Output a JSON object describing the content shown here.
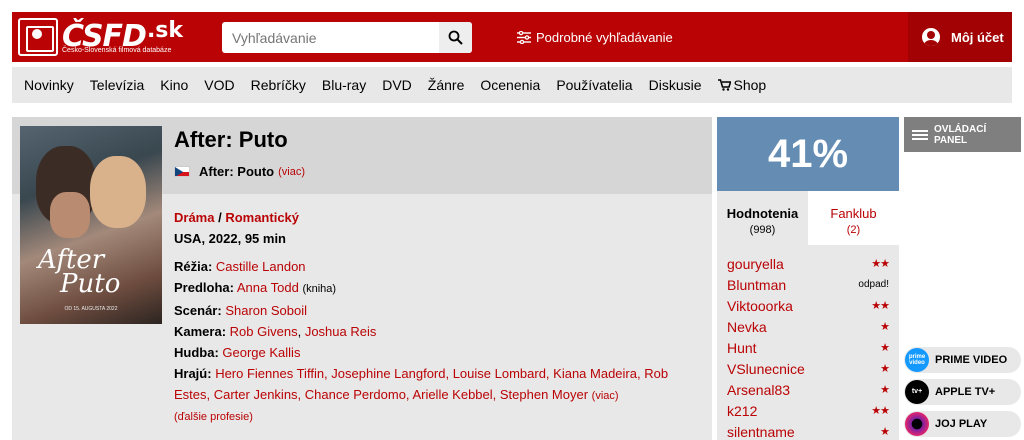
{
  "header": {
    "logo_text": "ČSFD",
    "logo_domain": ".sk",
    "logo_tagline": "Česko-Slovenská filmová databáze",
    "search_placeholder": "Vyhľadávanie",
    "advanced_search": "Podrobné vyhľadávanie",
    "account": "Môj účet"
  },
  "nav": {
    "items": [
      "Novinky",
      "Televízia",
      "Kino",
      "VOD",
      "Rebríčky",
      "Blu-ray",
      "DVD",
      "Žánre",
      "Ocenenia",
      "Používatelia",
      "Diskusie",
      "Shop"
    ]
  },
  "film": {
    "title": "After: Puto",
    "original_title": "After: Pouto",
    "original_more": "(viac)",
    "genre1": "Dráma",
    "genre_sep": " / ",
    "genre2": "Romantický",
    "meta": "USA, 2022, 95 min",
    "poster": {
      "title_line1": "After",
      "title_line2": "Puto",
      "footer": "OD 15. AUGUSTA 2022"
    },
    "crew": [
      {
        "label": "Réžia:",
        "names": [
          "Castille Landon"
        ]
      },
      {
        "label": "Predloha:",
        "names": [
          "Anna Todd"
        ],
        "note": "(kniha)"
      },
      {
        "label": "Scenár:",
        "names": [
          "Sharon Soboil"
        ]
      },
      {
        "label": "Kamera:",
        "names": [
          "Rob Givens",
          "Joshua Reis"
        ]
      },
      {
        "label": "Hudba:",
        "names": [
          "George Kallis"
        ]
      }
    ],
    "cast_label": "Hrajú:",
    "cast_line1": "Hero Fiennes Tiffin, Josephine Langford, Louise Lombard, Kiana Madeira, Rob",
    "cast_line2": "Estes, Carter Jenkins, Chance Perdomo, Arielle Kebbel, Stephen Moyer",
    "cast_more": "(viac)",
    "more_professions": "(ďalšie profesie)"
  },
  "rating": {
    "percent": "41%",
    "color": "#658db4",
    "tab_ratings": "Hodnotenia",
    "tab_ratings_count": "(998)",
    "tab_fanclub": "Fanklub",
    "tab_fanclub_count": "(2)"
  },
  "user_ratings": [
    {
      "name": "gouryella",
      "stars": "★★"
    },
    {
      "name": "Bluntman",
      "stars": "odpad!"
    },
    {
      "name": "Viktooorka",
      "stars": "★★"
    },
    {
      "name": "Nevka",
      "stars": "★"
    },
    {
      "name": "Hunt",
      "stars": "★"
    },
    {
      "name": "VSlunecnice",
      "stars": "★"
    },
    {
      "name": "Arsenal83",
      "stars": "★"
    },
    {
      "name": "k212",
      "stars": "★★"
    },
    {
      "name": "silentname",
      "stars": "★"
    }
  ],
  "sidebar": {
    "control_panel": "OVLÁDACÍ PANEL",
    "vod": [
      {
        "label": "PRIME VIDEO",
        "icon_text": "prime video",
        "color": "#1399ff"
      },
      {
        "label": "APPLE TV+",
        "icon_text": "tv+",
        "color": "#000000"
      },
      {
        "label": "JOJ PLAY",
        "icon_text": "",
        "color": "#7a1fa2"
      }
    ]
  },
  "colors": {
    "brand": "#ba0305",
    "rating_blue": "#658db4"
  }
}
